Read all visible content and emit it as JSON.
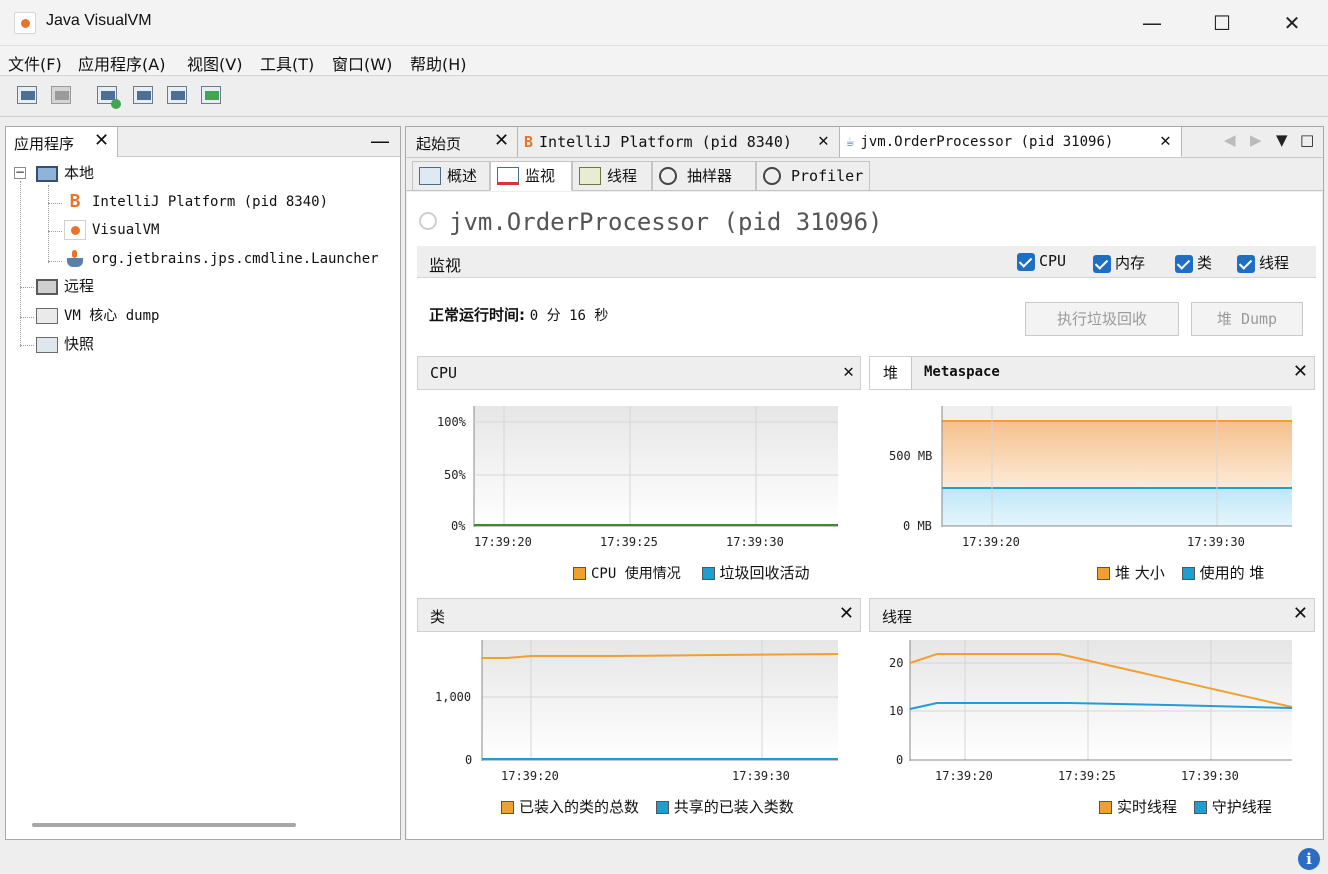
{
  "window": {
    "title": "Java VisualVM"
  },
  "menu": [
    "文件(F)",
    "应用程序(A)",
    "视图(V)",
    "工具(T)",
    "窗口(W)",
    "帮助(H)"
  ],
  "left_panel": {
    "tab_label": "应用程序",
    "tree": {
      "local": "本地",
      "local_children": [
        "IntelliJ Platform (pid 8340)",
        "VisualVM",
        "org.jetbrains.jps.cmdline.Launcher"
      ],
      "remote": "远程",
      "vm_coredump": "VM 核心 dump",
      "snapshots": "快照"
    }
  },
  "doc_tabs": [
    "起始页",
    "IntelliJ Platform (pid 8340)",
    "jvm.OrderProcessor (pid 31096)"
  ],
  "sub_tabs": [
    "概述",
    "监视",
    "线程",
    "抽样器",
    "Profiler"
  ],
  "monitor": {
    "app_title": "jvm.OrderProcessor (pid 31096)",
    "section_label": "监视",
    "checkboxes": [
      "CPU",
      "内存",
      "类",
      "线程"
    ],
    "uptime_label": "正常运行时间:",
    "uptime_value": "0 分 16 秒",
    "gc_button": "执行垃圾回收",
    "heapdump_button": "堆 Dump"
  },
  "panels": {
    "cpu": {
      "title": "CPU",
      "legend": [
        "CPU 使用情况",
        "垃圾回收活动"
      ]
    },
    "heap": {
      "tabs": [
        "堆",
        "Metaspace"
      ],
      "legend": [
        "堆 大小",
        "使用的 堆"
      ]
    },
    "classes": {
      "title": "类",
      "legend": [
        "已装入的类的总数",
        "共享的已装入类数"
      ]
    },
    "threads": {
      "title": "线程",
      "legend": [
        "实时线程",
        "守护线程"
      ]
    }
  },
  "colors": {
    "orange": "#f0a030",
    "blue": "#1e9fd4",
    "accent": "#1e6fc4"
  },
  "chart_data": [
    {
      "type": "line",
      "title": "CPU",
      "x": [
        "17:39:20",
        "17:39:25",
        "17:39:30"
      ],
      "yticks": [
        "100%",
        "50%",
        "0%"
      ],
      "ylim": [
        0,
        100
      ],
      "series": [
        {
          "name": "CPU 使用情况",
          "values": [
            0,
            0,
            0
          ]
        },
        {
          "name": "垃圾回收活动",
          "values": [
            0,
            0,
            0
          ]
        }
      ]
    },
    {
      "type": "area",
      "title": "堆",
      "x": [
        "17:39:20",
        "17:39:30"
      ],
      "yticks": [
        "500 MB",
        "0 MB"
      ],
      "series": [
        {
          "name": "堆 大小",
          "values": [
            780,
            780
          ]
        },
        {
          "name": "使用的 堆",
          "values": [
            200,
            200
          ]
        }
      ]
    },
    {
      "type": "line",
      "title": "类",
      "x": [
        "17:39:20",
        "17:39:30"
      ],
      "yticks": [
        "1,000",
        "0"
      ],
      "series": [
        {
          "name": "已装入的类的总数",
          "values": [
            1600,
            1640,
            1640,
            1650
          ]
        },
        {
          "name": "共享的已装入类数",
          "values": [
            0,
            0,
            0,
            0
          ]
        }
      ]
    },
    {
      "type": "line",
      "title": "线程",
      "x": [
        "17:39:20",
        "17:39:25",
        "17:39:30"
      ],
      "yticks": [
        "20",
        "10",
        "0"
      ],
      "series": [
        {
          "name": "实时线程",
          "values": [
            20,
            22,
            22,
            22,
            11
          ]
        },
        {
          "name": "守护线程",
          "values": [
            10,
            12,
            12,
            12,
            11
          ]
        }
      ]
    }
  ]
}
